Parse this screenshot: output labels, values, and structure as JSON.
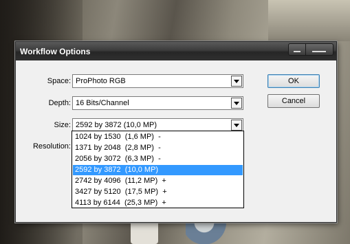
{
  "dialog": {
    "title": "Workflow Options",
    "space": {
      "label": "Space:",
      "value": "ProPhoto RGB"
    },
    "depth": {
      "label": "Depth:",
      "value": "16 Bits/Channel"
    },
    "size": {
      "label": "Size:",
      "value": "2592 by 3872  (10,0 MP)",
      "options": [
        "1024 by 1530  (1,6 MP)  -",
        "1371 by 2048  (2,8 MP)  -",
        "2056 by 3072  (6,3 MP)  -",
        "2592 by 3872  (10,0 MP)",
        "2742 by 4096  (11,2 MP)  +",
        "3427 by 5120  (17,5 MP)  +",
        "4113 by 6144  (25,3 MP)  +"
      ],
      "selected_index": 3
    },
    "resolution": {
      "label": "Resolution:"
    },
    "ok_label": "OK",
    "cancel_label": "Cancel"
  }
}
